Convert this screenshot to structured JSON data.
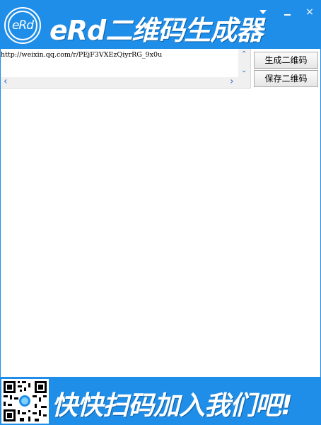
{
  "titlebar": {
    "logo_text": "eRd",
    "title": "eRd二维码生成器",
    "menu_icon": "dropdown-triangle",
    "minimize_icon": "minimize-bar",
    "close_label": "×"
  },
  "input": {
    "url_value": "http://weixin.qq.com/r/PEjF3VXEzQiyrRG_9x0u",
    "scroll_up": "⌃",
    "scroll_down": "⌄",
    "scroll_left": "‹",
    "scroll_right": "›"
  },
  "buttons": {
    "generate_label": "生成二维码",
    "save_label": "保存二维码"
  },
  "footer": {
    "slogan": "快快扫码加入我们吧!"
  },
  "colors": {
    "brand_blue": "#1f8ee8",
    "scroll_arrow": "#3b72c8"
  }
}
